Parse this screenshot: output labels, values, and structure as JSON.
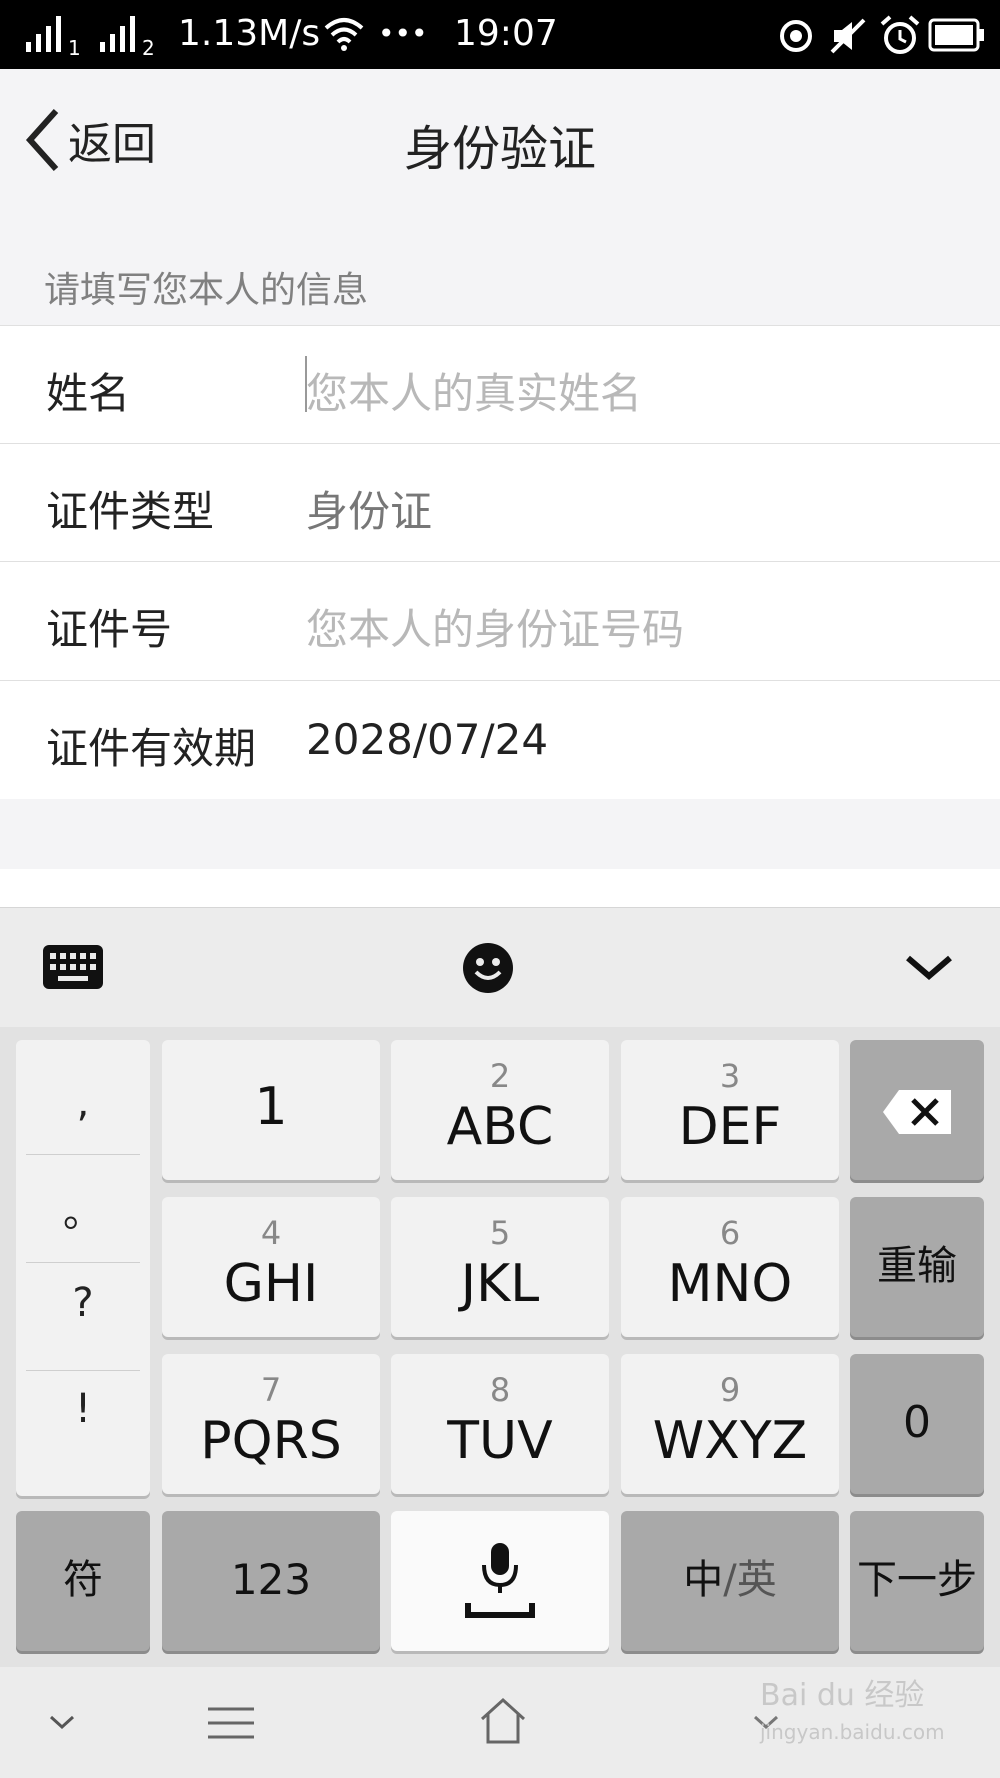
{
  "status_bar": {
    "sim1": "1",
    "sim2": "2",
    "speed": "1.13M/s",
    "dots": "•••",
    "time": "19:07"
  },
  "header": {
    "back_label": "返回",
    "title": "身份验证"
  },
  "form": {
    "section_label": "请填写您本人的信息",
    "rows": [
      {
        "label": "姓名",
        "value": "您本人的真实姓名"
      },
      {
        "label": "证件类型",
        "value": "身份证"
      },
      {
        "label": "证件号",
        "value": "您本人的身份证号码"
      },
      {
        "label": "证件有效期",
        "value": "2028/07/24"
      }
    ]
  },
  "keyboard": {
    "punctuation": [
      ",",
      "。",
      "?",
      "!"
    ],
    "keys": {
      "k1": {
        "num": "",
        "letters": "1"
      },
      "k2": {
        "num": "2",
        "letters": "ABC"
      },
      "k3": {
        "num": "3",
        "letters": "DEF"
      },
      "k4": {
        "num": "4",
        "letters": "GHI"
      },
      "k5": {
        "num": "5",
        "letters": "JKL"
      },
      "k6": {
        "num": "6",
        "letters": "MNO"
      },
      "k7": {
        "num": "7",
        "letters": "PQRS"
      },
      "k8": {
        "num": "8",
        "letters": "TUV"
      },
      "k9": {
        "num": "9",
        "letters": "WXYZ"
      }
    },
    "reenter": "重输",
    "zero": "0",
    "symbols": "符",
    "numeric": "123",
    "lang_cn": "中",
    "lang_sep": "/",
    "lang_en": "英",
    "next": "下一步"
  },
  "watermark": {
    "brand": "Bai du 经验",
    "url": "jingyan.baidu.com"
  }
}
